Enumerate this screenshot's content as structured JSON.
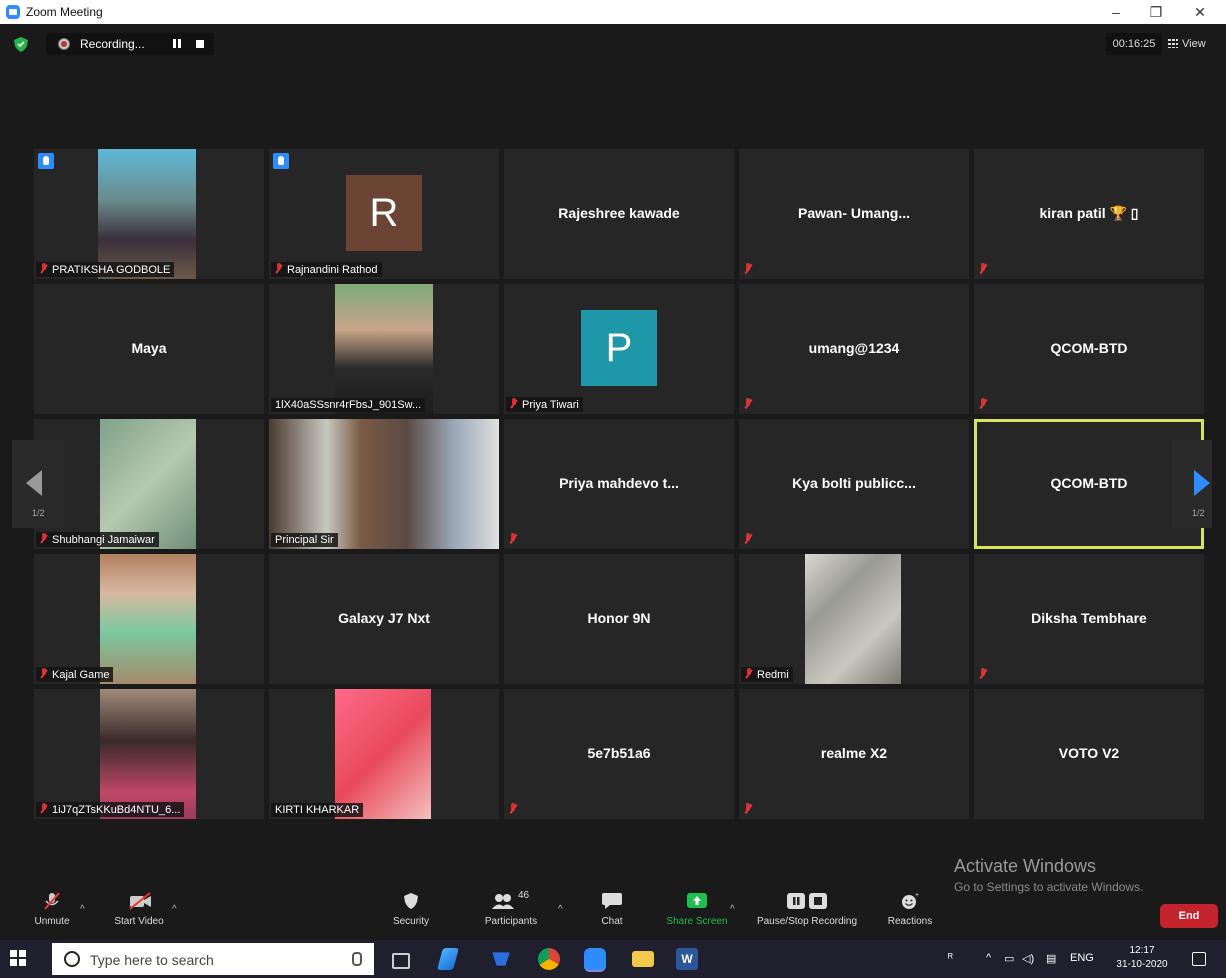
{
  "window": {
    "title": "Zoom Meeting",
    "minimize": "–",
    "restore": "❐",
    "close": "✕"
  },
  "recording": {
    "label": "Recording..."
  },
  "timer": "00:16:25",
  "view_label": "View",
  "pager": {
    "left": "1/2",
    "right": "1/2"
  },
  "participants_grid": [
    [
      {
        "name": "PRATIKSHA GODBOLE",
        "muted": true,
        "hand": true,
        "video": "photo"
      },
      {
        "name": "Rajnandini Rathod",
        "muted": true,
        "hand": true,
        "avatar": "R",
        "avatar_color": "#6b4433"
      },
      {
        "name": "Rajeshree kawade",
        "muted": false
      },
      {
        "name": "Pawan- Umang...",
        "muted": true
      },
      {
        "name": "kiran patil 🏆 ▯",
        "muted": true
      }
    ],
    [
      {
        "name": "Maya",
        "muted": false
      },
      {
        "name": "1lX40aSSsnr4rFbsJ_901Sw...",
        "muted": false,
        "video": "photo"
      },
      {
        "name": "Priya Tiwari",
        "muted": true,
        "avatar": "P",
        "avatar_color": "#1e97a8"
      },
      {
        "name": "umang@1234",
        "muted": true
      },
      {
        "name": "QCOM-BTD",
        "muted": true
      }
    ],
    [
      {
        "name": "Shubhangi Jamaiwar",
        "muted": true,
        "video": "blur"
      },
      {
        "name": "Principal Sir",
        "muted": false,
        "video": "wide"
      },
      {
        "name": "Priya mahdevo t...",
        "muted": true
      },
      {
        "name": "Kya bolti publicc...",
        "muted": true
      },
      {
        "name": "QCOM-BTD",
        "muted": false,
        "active": true
      }
    ],
    [
      {
        "name": "Kajal Game",
        "muted": true,
        "video": "photo"
      },
      {
        "name": "Galaxy J7 Nxt",
        "muted": false
      },
      {
        "name": "Honor 9N",
        "muted": false
      },
      {
        "name": "Redmi",
        "muted": true,
        "video": "photo"
      },
      {
        "name": "Diksha Tembhare",
        "muted": true
      }
    ],
    [
      {
        "name": "1iJ7qZTsKKuBd4NTU_6...",
        "muted": true,
        "video": "photo"
      },
      {
        "name": "KIRTI KHARKAR",
        "muted": false,
        "video": "photo"
      },
      {
        "name": "5e7b51a6",
        "muted": true
      },
      {
        "name": "realme X2",
        "muted": true
      },
      {
        "name": "VOTO V2",
        "muted": false
      }
    ]
  ],
  "activate": {
    "line1": "Activate Windows",
    "line2": "Go to Settings to activate Windows."
  },
  "toolbar": {
    "unmute": "Unmute",
    "start_video": "Start Video",
    "security": "Security",
    "participants": "Participants",
    "participants_count": "46",
    "chat": "Chat",
    "share_screen": "Share Screen",
    "pause_stop": "Pause/Stop Recording",
    "reactions": "Reactions",
    "end": "End"
  },
  "taskbar": {
    "search_placeholder": "Type here to search",
    "lang": "ENG",
    "time": "12:17",
    "date": "31-10-2020"
  },
  "colors": {
    "accent": "#2d8cff",
    "active_border": "#d6e55a",
    "end": "#c4232b",
    "share": "#1fbf4f"
  }
}
